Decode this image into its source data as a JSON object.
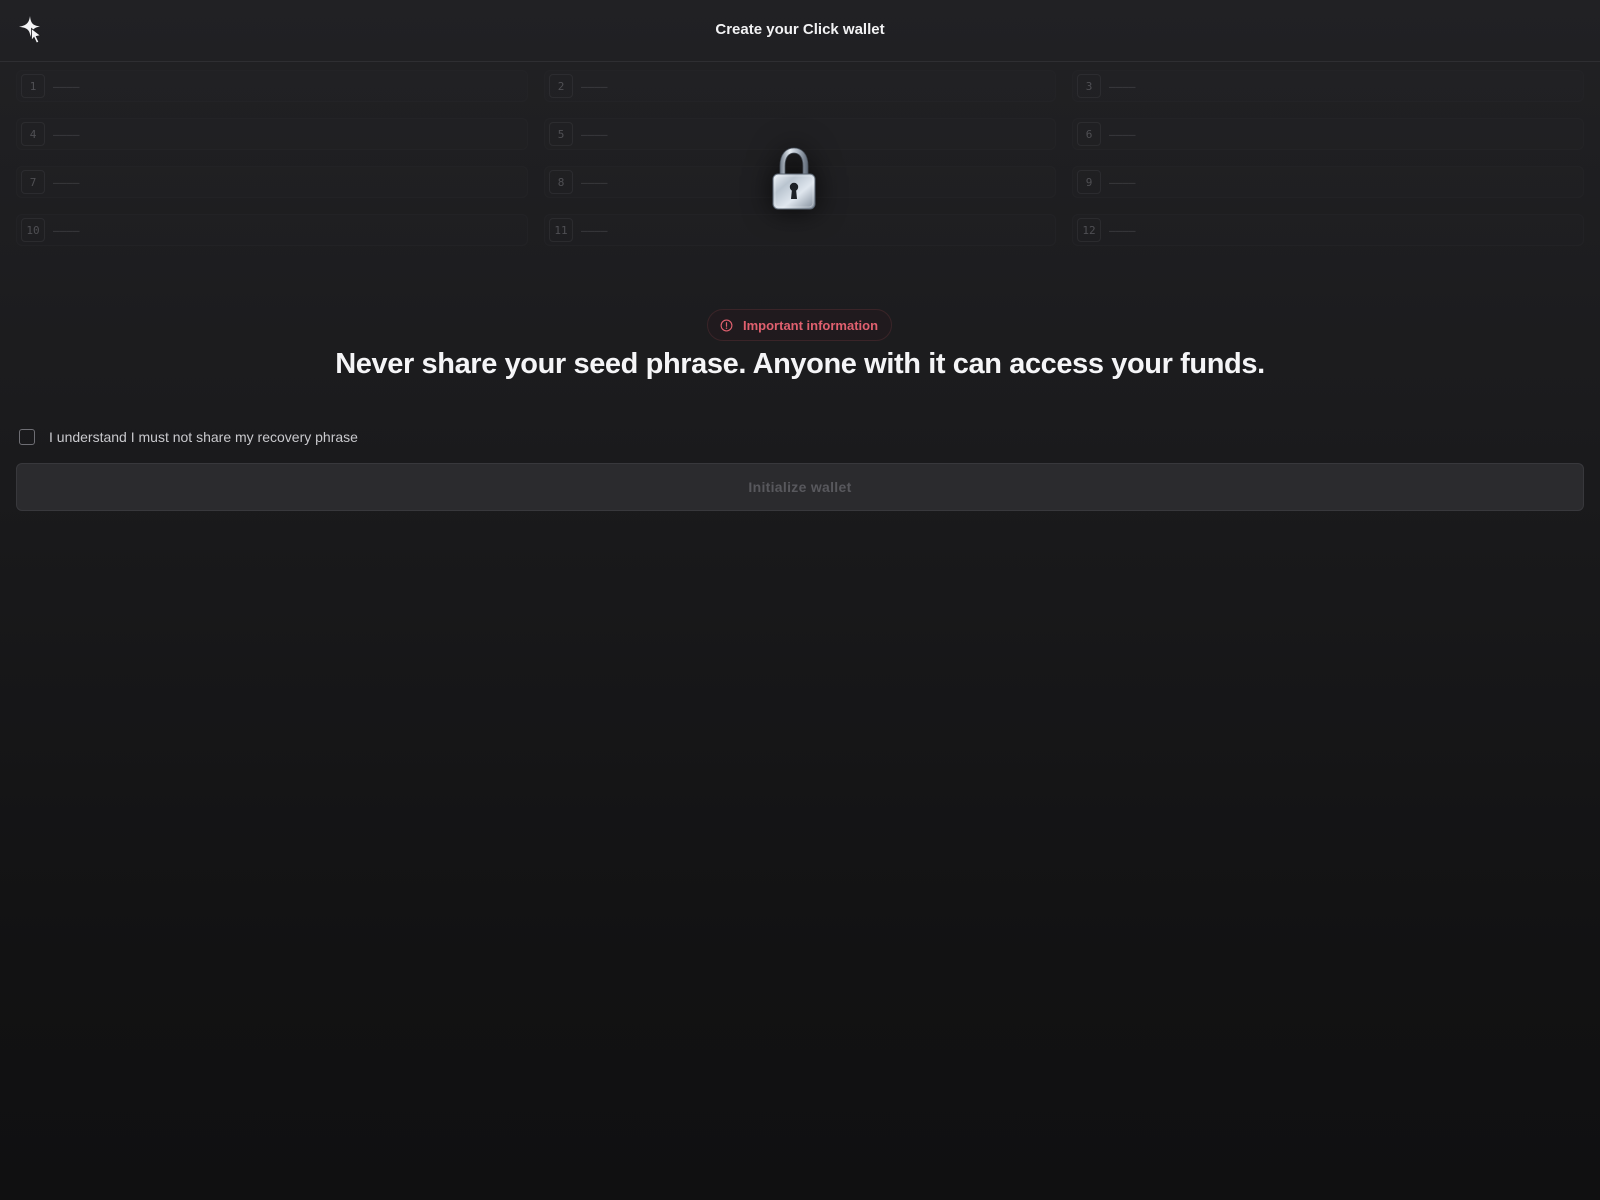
{
  "header": {
    "title": "Create your Click wallet",
    "logo_icon": "star-sparkle-icon"
  },
  "seed_phrase": {
    "words": [
      {
        "index": "1",
        "word": "————"
      },
      {
        "index": "2",
        "word": "————"
      },
      {
        "index": "3",
        "word": "————"
      },
      {
        "index": "4",
        "word": "————"
      },
      {
        "index": "5",
        "word": "————"
      },
      {
        "index": "6",
        "word": "————"
      },
      {
        "index": "7",
        "word": "————"
      },
      {
        "index": "8",
        "word": "————"
      },
      {
        "index": "9",
        "word": "————"
      },
      {
        "index": "10",
        "word": "————"
      },
      {
        "index": "11",
        "word": "————"
      },
      {
        "index": "12",
        "word": "————"
      }
    ],
    "overlay_icon": "padlock-icon"
  },
  "warning": {
    "badge_icon": "alert-circle-icon",
    "badge_label": "Important information",
    "badge_color": "#e0606f",
    "headline": "Never share your seed phrase. Anyone with it can access your funds."
  },
  "acknowledgement": {
    "checked": false,
    "label": "I understand I must not share my recovery phrase"
  },
  "actions": {
    "initialize_label": "Initialize wallet",
    "initialize_disabled": true
  }
}
